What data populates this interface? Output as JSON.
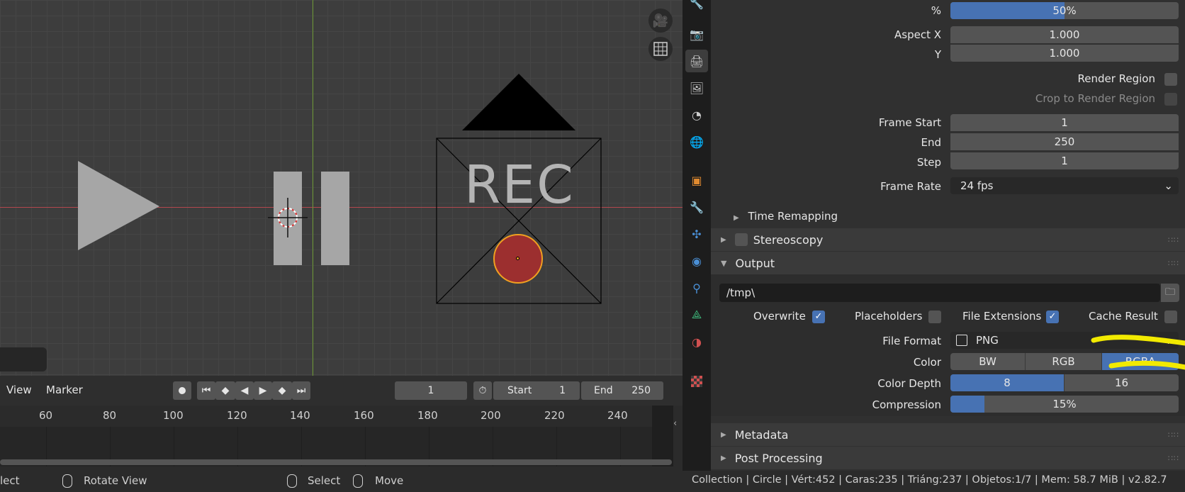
{
  "viewport": {
    "rec_text": "REC"
  },
  "timeline": {
    "menu_view": "View",
    "menu_marker": "Marker",
    "current_frame": "1",
    "start_label": "Start",
    "start_value": "1",
    "end_label": "End",
    "end_value": "250",
    "ruler_ticks": [
      "60",
      "80",
      "100",
      "120",
      "140",
      "160",
      "180",
      "200",
      "220",
      "240"
    ]
  },
  "status": {
    "select_left": "lect",
    "rotate_view": "Rotate View",
    "select": "Select",
    "move": "Move",
    "info": "Collection | Circle | Vért:452 | Caras:235 | Triáng:237 | Objetos:1/7 | Mem: 58.7 MiB | v2.82.7"
  },
  "properties": {
    "percent_label": "%",
    "percent_value": "50%",
    "percent_fraction": 0.5,
    "aspect_x_label": "Aspect X",
    "aspect_x_value": "1.000",
    "aspect_y_label": "Y",
    "aspect_y_value": "1.000",
    "render_region_label": "Render Region",
    "crop_region_label": "Crop to Render Region",
    "frame_start_label": "Frame Start",
    "frame_start_value": "1",
    "end_label": "End",
    "end_value": "250",
    "step_label": "Step",
    "step_value": "1",
    "frame_rate_label": "Frame Rate",
    "frame_rate_value": "24 fps",
    "time_remapping": "Time Remapping",
    "stereoscopy": "Stereoscopy",
    "output": "Output",
    "output_path": "/tmp\\",
    "overwrite": "Overwrite",
    "placeholders": "Placeholders",
    "file_extensions": "File Extensions",
    "cache_result": "Cache Result",
    "file_format_label": "File Format",
    "file_format_value": "PNG",
    "color_label": "Color",
    "color_bw": "BW",
    "color_rgb": "RGB",
    "color_rgba": "RGBA",
    "color_depth_label": "Color Depth",
    "depth_8": "8",
    "depth_16": "16",
    "compression_label": "Compression",
    "compression_value": "15%",
    "compression_fraction": 0.15,
    "metadata": "Metadata",
    "post_processing": "Post Processing"
  },
  "colors": {
    "accent": "#4772b3",
    "highlight_annotation": "#f2ea00",
    "record_dot": "#9c2f2f"
  }
}
